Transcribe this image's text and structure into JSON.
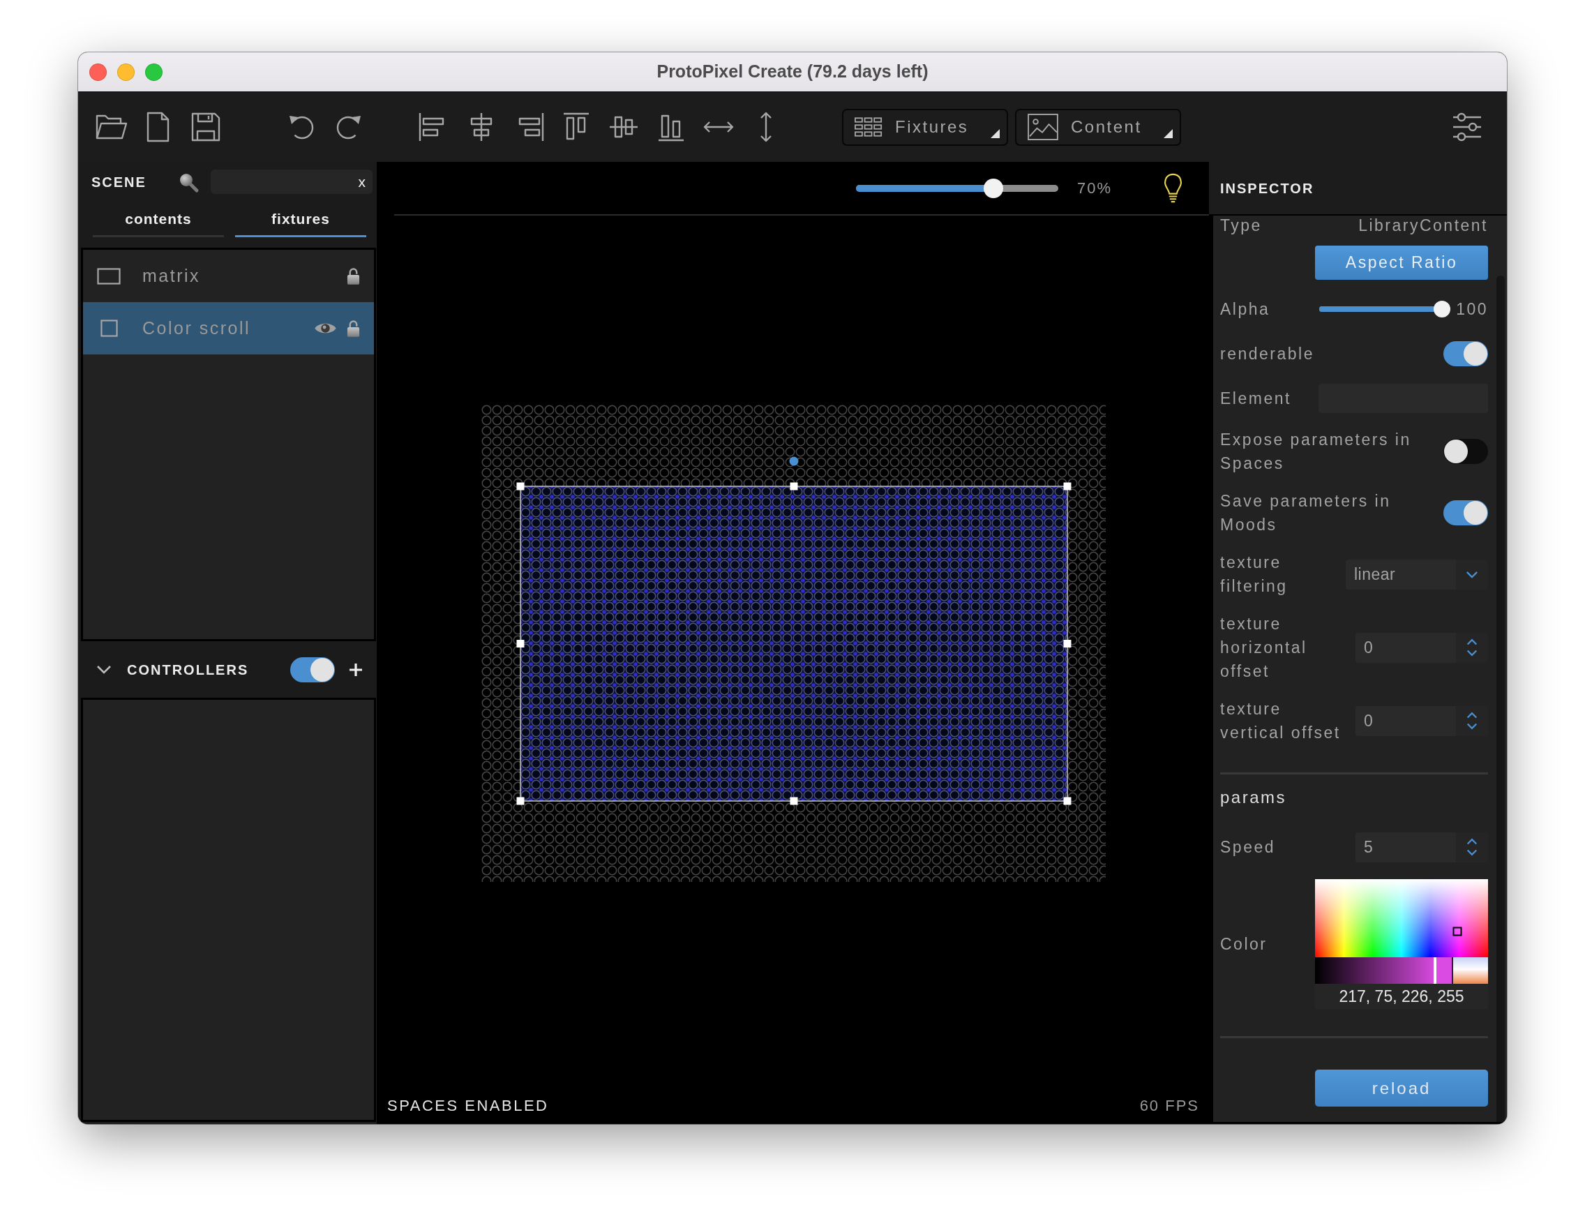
{
  "window": {
    "title": "ProtoPixel Create (79.2 days left)"
  },
  "toolbar": {
    "dropdowns": [
      {
        "label": "Fixtures"
      },
      {
        "label": "Content"
      }
    ]
  },
  "scene": {
    "title": "SCENE",
    "search": {
      "clear": "x"
    },
    "tabs": [
      {
        "label": "contents",
        "selected": false
      },
      {
        "label": "fixtures",
        "selected": true
      }
    ],
    "items": [
      {
        "kind": "rectangle",
        "name": "matrix",
        "selected": false,
        "visible": false
      },
      {
        "kind": "square",
        "name": "Color scroll",
        "selected": true,
        "visible": true
      }
    ]
  },
  "controllers": {
    "title": "CONTROLLERS",
    "expanded": true,
    "on": true
  },
  "canvas": {
    "zoom": {
      "level": 0.7,
      "reading": "70%"
    },
    "status": "SPACES ENABLED",
    "fps": "60 FPS"
  },
  "inspector": {
    "title": "INSPECTOR",
    "sections": [
      {
        "rows": [
          {
            "kind": "text",
            "label": "Type",
            "value": "LibraryContent"
          },
          {
            "kind": "button",
            "label": "Aspect Ratio"
          },
          {
            "kind": "slider",
            "label": "Alpha",
            "level": 1,
            "reading": "100"
          },
          {
            "kind": "switch",
            "label": "renderable",
            "on": true
          },
          {
            "kind": "input",
            "label": "Element"
          },
          {
            "kind": "switch",
            "label": "Expose parameters in Spaces",
            "on": false
          },
          {
            "kind": "switch",
            "label": "Save parameters in Moods",
            "on": true
          },
          {
            "kind": "select",
            "label": "texture filtering",
            "value": "linear"
          },
          {
            "kind": "number",
            "label": "texture horizontal offset",
            "value": "0"
          },
          {
            "kind": "number",
            "label": "texture vertical offset",
            "value": "0"
          }
        ]
      },
      {
        "title": "params",
        "rows": [
          {
            "kind": "number",
            "label": "Speed",
            "value": "5"
          },
          {
            "kind": "color",
            "label": "Color",
            "color": "#d94be2",
            "value": "217, 75, 226, 255"
          }
        ]
      }
    ],
    "button": "reload"
  }
}
